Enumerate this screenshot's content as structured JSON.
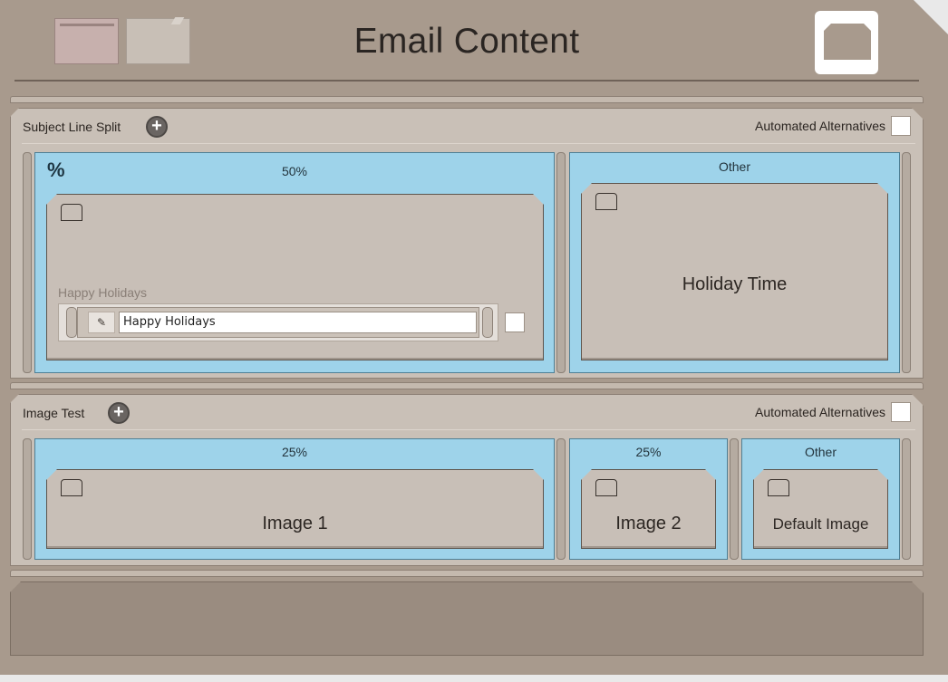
{
  "header": {
    "title": "Email Content"
  },
  "splits": [
    {
      "title": "Subject Line Split",
      "automated_label": "Automated Alternatives",
      "variants": [
        {
          "percent": "50%",
          "field_label": "Happy Holidays",
          "field_value": "Happy Holidays"
        },
        {
          "percent": "Other",
          "content": "Holiday Time"
        }
      ]
    },
    {
      "title": "Image Test",
      "automated_label": "Automated Alternatives",
      "variants": [
        {
          "percent": "25%",
          "content": "Image 1"
        },
        {
          "percent": "25%",
          "content": "Image 2"
        },
        {
          "percent": "Other",
          "content": "Default Image"
        }
      ]
    }
  ],
  "icons": {
    "percent": "%",
    "add": "+",
    "pen": "✎"
  },
  "colors": {
    "frame": "#a89a8d",
    "panel": "#c9c0b7",
    "variant": "#9ed3ea",
    "card": "#c8bfb7"
  }
}
